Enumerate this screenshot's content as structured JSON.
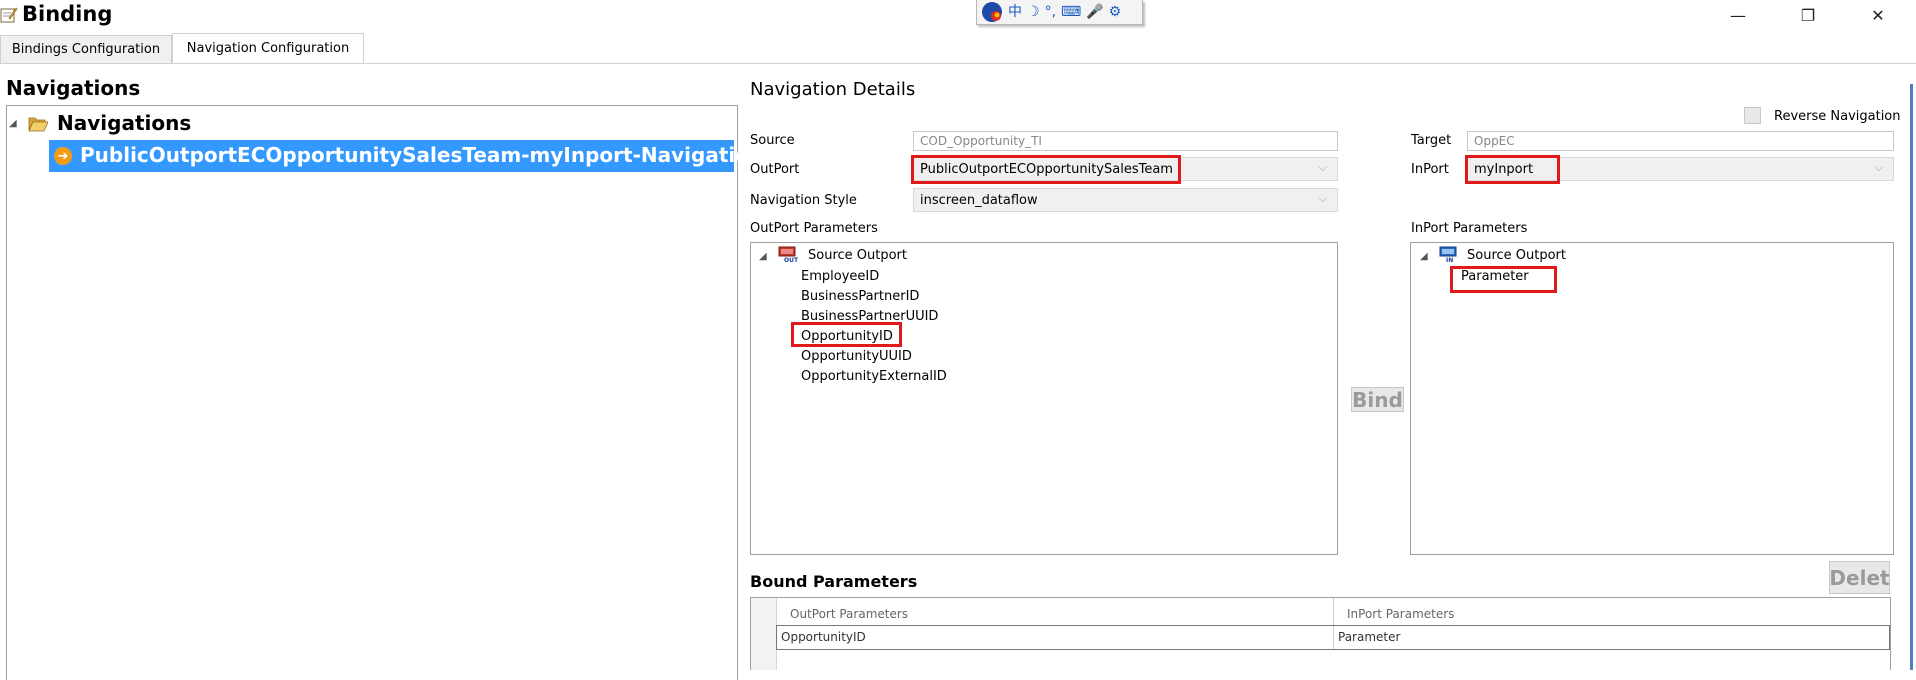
{
  "window": {
    "title": "Binding",
    "minimize_glyph": "—",
    "maximize_glyph": "❐",
    "close_glyph": "✕"
  },
  "ime_toolbar": {
    "items": [
      "中",
      "☽",
      "°,",
      "⌨",
      "🎤",
      "⚙"
    ]
  },
  "tabs": [
    {
      "label": "Bindings Configuration",
      "active": false
    },
    {
      "label": "Navigation Configuration",
      "active": true
    }
  ],
  "navigations": {
    "header": "Navigations",
    "tree": {
      "root_label": "Navigations",
      "items": [
        {
          "label": "PublicOutportECOpportunitySalesTeam-myInport-Navigation",
          "selected": true
        }
      ]
    }
  },
  "details": {
    "title": "Navigation Details",
    "reverse_navigation_label": "Reverse Navigation",
    "reverse_navigation_checked": false,
    "source_label": "Source",
    "source_value": "COD_Opportunity_TI",
    "target_label": "Target",
    "target_value": "OppEC",
    "outport_label": "OutPort",
    "outport_value": "PublicOutportECOpportunitySalesTeam",
    "inport_label": "InPort",
    "inport_value": "myInport",
    "nav_style_label": "Navigation Style",
    "nav_style_value": "inscreen_dataflow",
    "outport_params_label": "OutPort Parameters",
    "inport_params_label": "InPort Parameters",
    "outport_tree": {
      "root_label": "Source Outport",
      "params": [
        "EmployeeID",
        "BusinessPartnerID",
        "BusinessPartnerUUID",
        "OpportunityID",
        "OpportunityUUID",
        "OpportunityExternalID"
      ]
    },
    "inport_tree": {
      "root_label": "Source Outport",
      "params": [
        "Parameter"
      ]
    },
    "bind_button": "Bind",
    "delete_button": "Delet"
  },
  "bound_parameters": {
    "title": "Bound Parameters",
    "columns": [
      "OutPort Parameters",
      "InPort Parameters"
    ],
    "rows": [
      {
        "outport": "OpportunityID",
        "inport": "Parameter"
      }
    ]
  },
  "colors": {
    "selection": "#3399ff",
    "highlight_box": "#e01a1a",
    "folder": "#e8b84a",
    "nav_item_icon": "#f39c12"
  }
}
